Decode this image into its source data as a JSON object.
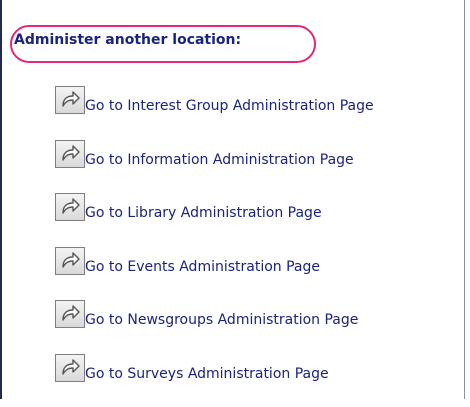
{
  "header": {
    "title": "Administer another location:"
  },
  "links": [
    {
      "label": "Go to Interest Group Administration Page",
      "icon": "share-arrow-icon"
    },
    {
      "label": "Go to Information Administration Page",
      "icon": "share-arrow-icon"
    },
    {
      "label": "Go to Library Administration Page",
      "icon": "share-arrow-icon"
    },
    {
      "label": "Go to Events Administration Page",
      "icon": "share-arrow-icon"
    },
    {
      "label": "Go to Newsgroups Administration Page",
      "icon": "share-arrow-icon"
    },
    {
      "label": "Go to Surveys Administration Page",
      "icon": "share-arrow-icon"
    }
  ],
  "colors": {
    "link_text": "#1a237e",
    "header_text": "#1a237e",
    "header_highlight": "#e0297a",
    "frame_border": "#1f2a55"
  }
}
